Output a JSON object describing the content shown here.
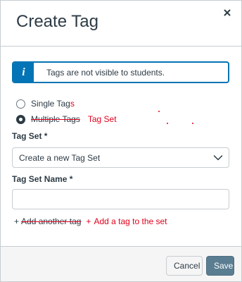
{
  "dialog": {
    "title": "Create Tag",
    "close_icon": "close-icon"
  },
  "info": {
    "icon": "info-icon",
    "icon_glyph": "i",
    "message": "Tags are not visible to students."
  },
  "tag_type": {
    "options": [
      {
        "label": "Single Tag",
        "annotation": "s",
        "selected": false
      },
      {
        "label": "Multiple Tags",
        "annotation": "Tag Set",
        "selected": true
      }
    ]
  },
  "tag_set": {
    "label": "Tag Set *",
    "selected_value": "Create a new Tag Set"
  },
  "tag_set_name": {
    "label": "Tag Set Name *",
    "value": "",
    "placeholder": ""
  },
  "add_tag": {
    "plus": "+",
    "label": "Add another tag",
    "annotation_plus": "+",
    "annotation": "Add a tag to the set"
  },
  "footer": {
    "cancel_label": "Cancel",
    "save_label": "Save"
  },
  "colors": {
    "info_accent": "#0374b5",
    "annotation_red": "#e0001b",
    "save_button": "#5a7d91"
  }
}
